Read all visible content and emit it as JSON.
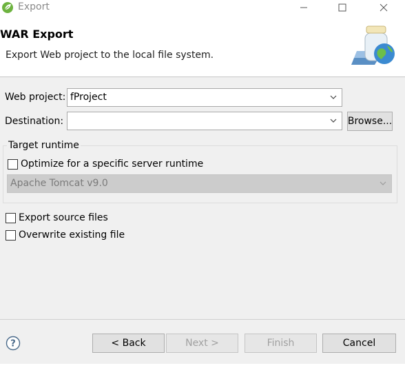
{
  "window": {
    "title": "Export",
    "minimize_icon": "minimize-icon",
    "maximize_icon": "maximize-icon",
    "close_icon": "close-icon"
  },
  "header": {
    "title": "WAR Export",
    "description": "Export Web project to the local file system."
  },
  "form": {
    "web_project_label": "Web project:",
    "web_project_value": "fProject",
    "destination_label": "Destination:",
    "destination_value": "",
    "browse_label": "Browse..."
  },
  "target_runtime": {
    "group_label": "Target runtime",
    "optimize_label": "Optimize for a specific server runtime",
    "optimize_checked": false,
    "runtime_value": "Apache Tomcat v9.0"
  },
  "options": {
    "export_source_label": "Export source files",
    "export_source_checked": false,
    "overwrite_label": "Overwrite existing file",
    "overwrite_checked": false
  },
  "buttons": {
    "back": "< Back",
    "next": "Next >",
    "finish": "Finish",
    "cancel": "Cancel"
  },
  "colors": {
    "accent": "#6db33f",
    "dialog_bg": "#f0f0f0"
  }
}
